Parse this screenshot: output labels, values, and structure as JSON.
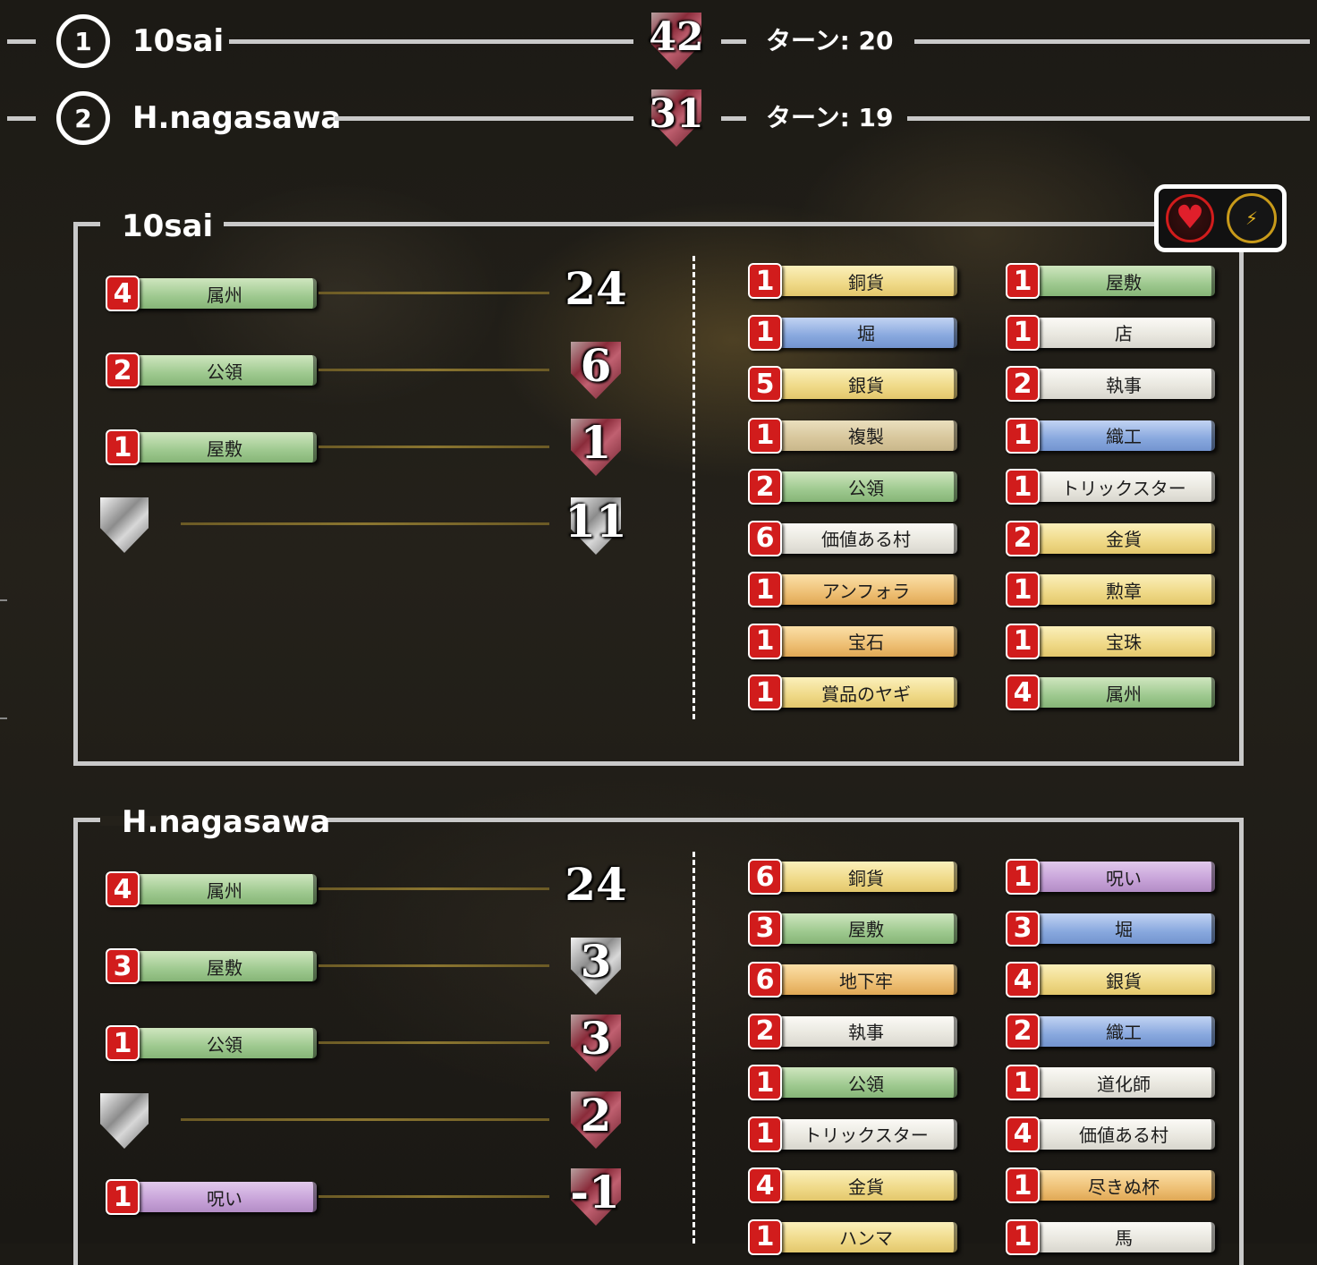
{
  "scoreboard": [
    {
      "rank": "1",
      "name": "10sai",
      "vp": "42",
      "turn": "ターン: 20"
    },
    {
      "rank": "2",
      "name": "H.nagasawa",
      "vp": "31",
      "turn": "ターン: 19"
    }
  ],
  "badges": {
    "heart_icon": "♥",
    "bolt_icon": "⚡"
  },
  "players": [
    {
      "name": "10sai",
      "vp_rows": [
        {
          "count": "4",
          "card": "属州",
          "color": "green",
          "vp": "24"
        },
        {
          "count": "2",
          "card": "公領",
          "color": "green",
          "vp": "6"
        },
        {
          "count": "1",
          "card": "屋敷",
          "color": "green",
          "vp": "1"
        },
        {
          "token": "vp-token",
          "vp": "11"
        }
      ],
      "deck_left": [
        {
          "count": "1",
          "card": "銅貨",
          "color": "yellow"
        },
        {
          "count": "1",
          "card": "堀",
          "color": "blue"
        },
        {
          "count": "5",
          "card": "銀貨",
          "color": "yellow"
        },
        {
          "count": "1",
          "card": "複製",
          "color": "tan"
        },
        {
          "count": "2",
          "card": "公領",
          "color": "green"
        },
        {
          "count": "6",
          "card": "価値ある村",
          "color": "white"
        },
        {
          "count": "1",
          "card": "アンフォラ",
          "color": "orange"
        },
        {
          "count": "1",
          "card": "宝石",
          "color": "orange"
        },
        {
          "count": "1",
          "card": "賞品のヤギ",
          "color": "yellow"
        }
      ],
      "deck_right": [
        {
          "count": "1",
          "card": "屋敷",
          "color": "green"
        },
        {
          "count": "1",
          "card": "店",
          "color": "white"
        },
        {
          "count": "2",
          "card": "執事",
          "color": "white"
        },
        {
          "count": "1",
          "card": "織工",
          "color": "blue"
        },
        {
          "count": "1",
          "card": "トリックスター",
          "color": "white"
        },
        {
          "count": "2",
          "card": "金貨",
          "color": "yellow"
        },
        {
          "count": "1",
          "card": "勲章",
          "color": "yellow"
        },
        {
          "count": "1",
          "card": "宝珠",
          "color": "yellow"
        },
        {
          "count": "4",
          "card": "属州",
          "color": "green"
        }
      ]
    },
    {
      "name": "H.nagasawa",
      "vp_rows": [
        {
          "count": "4",
          "card": "属州",
          "color": "green",
          "vp": "24"
        },
        {
          "count": "3",
          "card": "屋敷",
          "color": "green",
          "vp": "3"
        },
        {
          "count": "1",
          "card": "公領",
          "color": "green",
          "vp": "3"
        },
        {
          "token": "vp-token",
          "vp": "2"
        },
        {
          "count": "1",
          "card": "呪い",
          "color": "purple",
          "vp": "-1"
        }
      ],
      "deck_left": [
        {
          "count": "6",
          "card": "銅貨",
          "color": "yellow"
        },
        {
          "count": "3",
          "card": "屋敷",
          "color": "green"
        },
        {
          "count": "6",
          "card": "地下牢",
          "color": "orange"
        },
        {
          "count": "2",
          "card": "執事",
          "color": "white"
        },
        {
          "count": "1",
          "card": "公領",
          "color": "green"
        },
        {
          "count": "1",
          "card": "トリックスター",
          "color": "white"
        },
        {
          "count": "4",
          "card": "金貨",
          "color": "yellow"
        },
        {
          "count": "1",
          "card": "ハンマ",
          "color": "yellow"
        }
      ],
      "deck_right": [
        {
          "count": "1",
          "card": "呪い",
          "color": "purple"
        },
        {
          "count": "3",
          "card": "堀",
          "color": "blue"
        },
        {
          "count": "4",
          "card": "銀貨",
          "color": "yellow"
        },
        {
          "count": "2",
          "card": "織工",
          "color": "blue"
        },
        {
          "count": "1",
          "card": "道化師",
          "color": "white"
        },
        {
          "count": "4",
          "card": "価値ある村",
          "color": "white"
        },
        {
          "count": "1",
          "card": "尽きぬ杯",
          "color": "orange"
        },
        {
          "count": "1",
          "card": "馬",
          "color": "white"
        }
      ]
    }
  ]
}
